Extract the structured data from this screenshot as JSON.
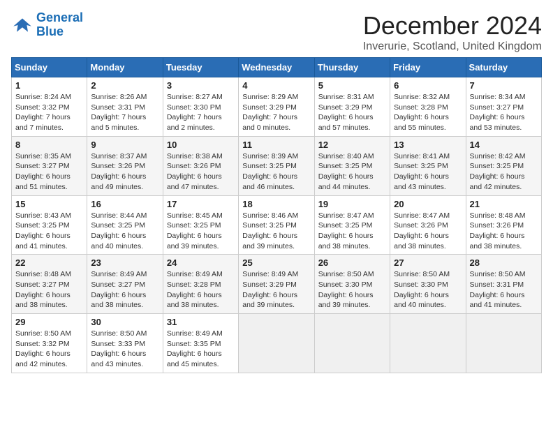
{
  "logo": {
    "line1": "General",
    "line2": "Blue"
  },
  "title": "December 2024",
  "subtitle": "Inverurie, Scotland, United Kingdom",
  "days_of_week": [
    "Sunday",
    "Monday",
    "Tuesday",
    "Wednesday",
    "Thursday",
    "Friday",
    "Saturday"
  ],
  "weeks": [
    [
      {
        "day": "1",
        "detail": "Sunrise: 8:24 AM\nSunset: 3:32 PM\nDaylight: 7 hours and 7 minutes."
      },
      {
        "day": "2",
        "detail": "Sunrise: 8:26 AM\nSunset: 3:31 PM\nDaylight: 7 hours and 5 minutes."
      },
      {
        "day": "3",
        "detail": "Sunrise: 8:27 AM\nSunset: 3:30 PM\nDaylight: 7 hours and 2 minutes."
      },
      {
        "day": "4",
        "detail": "Sunrise: 8:29 AM\nSunset: 3:29 PM\nDaylight: 7 hours and 0 minutes."
      },
      {
        "day": "5",
        "detail": "Sunrise: 8:31 AM\nSunset: 3:29 PM\nDaylight: 6 hours and 57 minutes."
      },
      {
        "day": "6",
        "detail": "Sunrise: 8:32 AM\nSunset: 3:28 PM\nDaylight: 6 hours and 55 minutes."
      },
      {
        "day": "7",
        "detail": "Sunrise: 8:34 AM\nSunset: 3:27 PM\nDaylight: 6 hours and 53 minutes."
      }
    ],
    [
      {
        "day": "8",
        "detail": "Sunrise: 8:35 AM\nSunset: 3:27 PM\nDaylight: 6 hours and 51 minutes."
      },
      {
        "day": "9",
        "detail": "Sunrise: 8:37 AM\nSunset: 3:26 PM\nDaylight: 6 hours and 49 minutes."
      },
      {
        "day": "10",
        "detail": "Sunrise: 8:38 AM\nSunset: 3:26 PM\nDaylight: 6 hours and 47 minutes."
      },
      {
        "day": "11",
        "detail": "Sunrise: 8:39 AM\nSunset: 3:25 PM\nDaylight: 6 hours and 46 minutes."
      },
      {
        "day": "12",
        "detail": "Sunrise: 8:40 AM\nSunset: 3:25 PM\nDaylight: 6 hours and 44 minutes."
      },
      {
        "day": "13",
        "detail": "Sunrise: 8:41 AM\nSunset: 3:25 PM\nDaylight: 6 hours and 43 minutes."
      },
      {
        "day": "14",
        "detail": "Sunrise: 8:42 AM\nSunset: 3:25 PM\nDaylight: 6 hours and 42 minutes."
      }
    ],
    [
      {
        "day": "15",
        "detail": "Sunrise: 8:43 AM\nSunset: 3:25 PM\nDaylight: 6 hours and 41 minutes."
      },
      {
        "day": "16",
        "detail": "Sunrise: 8:44 AM\nSunset: 3:25 PM\nDaylight: 6 hours and 40 minutes."
      },
      {
        "day": "17",
        "detail": "Sunrise: 8:45 AM\nSunset: 3:25 PM\nDaylight: 6 hours and 39 minutes."
      },
      {
        "day": "18",
        "detail": "Sunrise: 8:46 AM\nSunset: 3:25 PM\nDaylight: 6 hours and 39 minutes."
      },
      {
        "day": "19",
        "detail": "Sunrise: 8:47 AM\nSunset: 3:25 PM\nDaylight: 6 hours and 38 minutes."
      },
      {
        "day": "20",
        "detail": "Sunrise: 8:47 AM\nSunset: 3:26 PM\nDaylight: 6 hours and 38 minutes."
      },
      {
        "day": "21",
        "detail": "Sunrise: 8:48 AM\nSunset: 3:26 PM\nDaylight: 6 hours and 38 minutes."
      }
    ],
    [
      {
        "day": "22",
        "detail": "Sunrise: 8:48 AM\nSunset: 3:27 PM\nDaylight: 6 hours and 38 minutes."
      },
      {
        "day": "23",
        "detail": "Sunrise: 8:49 AM\nSunset: 3:27 PM\nDaylight: 6 hours and 38 minutes."
      },
      {
        "day": "24",
        "detail": "Sunrise: 8:49 AM\nSunset: 3:28 PM\nDaylight: 6 hours and 38 minutes."
      },
      {
        "day": "25",
        "detail": "Sunrise: 8:49 AM\nSunset: 3:29 PM\nDaylight: 6 hours and 39 minutes."
      },
      {
        "day": "26",
        "detail": "Sunrise: 8:50 AM\nSunset: 3:30 PM\nDaylight: 6 hours and 39 minutes."
      },
      {
        "day": "27",
        "detail": "Sunrise: 8:50 AM\nSunset: 3:30 PM\nDaylight: 6 hours and 40 minutes."
      },
      {
        "day": "28",
        "detail": "Sunrise: 8:50 AM\nSunset: 3:31 PM\nDaylight: 6 hours and 41 minutes."
      }
    ],
    [
      {
        "day": "29",
        "detail": "Sunrise: 8:50 AM\nSunset: 3:32 PM\nDaylight: 6 hours and 42 minutes."
      },
      {
        "day": "30",
        "detail": "Sunrise: 8:50 AM\nSunset: 3:33 PM\nDaylight: 6 hours and 43 minutes."
      },
      {
        "day": "31",
        "detail": "Sunrise: 8:49 AM\nSunset: 3:35 PM\nDaylight: 6 hours and 45 minutes."
      },
      {
        "day": "",
        "detail": ""
      },
      {
        "day": "",
        "detail": ""
      },
      {
        "day": "",
        "detail": ""
      },
      {
        "day": "",
        "detail": ""
      }
    ]
  ]
}
